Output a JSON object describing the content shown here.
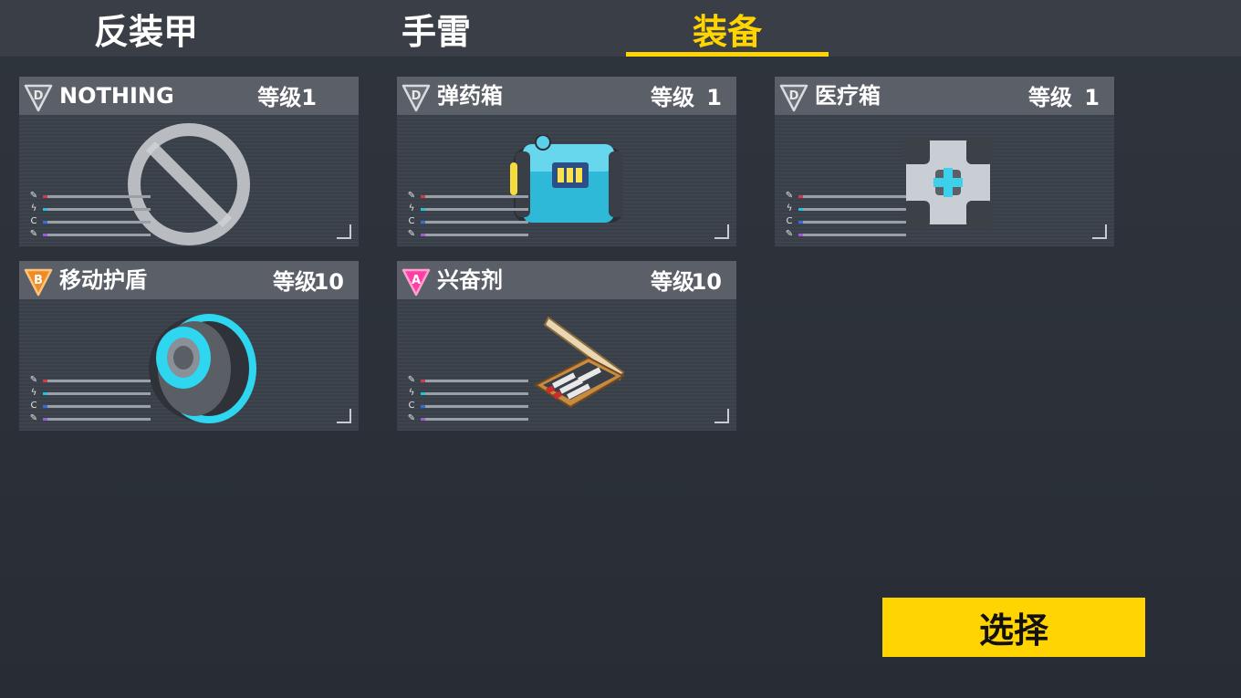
{
  "tabs": [
    {
      "label": "反装甲"
    },
    {
      "label": "手雷"
    },
    {
      "label": "装备"
    }
  ],
  "active_tab": "装备",
  "colors": {
    "accent": "#ffd400",
    "rank_D": "#c9ccd1",
    "rank_B": "#f08a24",
    "rank_A": "#ff3fa4",
    "stat_damage": "#d23a4a",
    "stat_energy": "#22c3d6",
    "stat_capacity": "#2e6fd8",
    "stat_range": "#9c5ad8"
  },
  "cards": [
    {
      "rank": "D",
      "name": "NOTHING",
      "level_label": "等级1",
      "level_value": "",
      "icon": "prohibited-icon"
    },
    {
      "rank": "D",
      "name": "弹药箱",
      "level_label": "等级",
      "level_value": "1",
      "icon": "ammo-box-icon"
    },
    {
      "rank": "D",
      "name": "医疗箱",
      "level_label": "等级",
      "level_value": "1",
      "icon": "medkit-icon"
    },
    {
      "rank": "B",
      "name": "移动护盾",
      "level_label": "等级",
      "level_value": "10",
      "icon": "mobile-shield-icon"
    },
    {
      "rank": "A",
      "name": "兴奋剂",
      "level_label": "等级",
      "level_value": "10",
      "icon": "stimulant-icon"
    }
  ],
  "stat_icons": [
    "damage-icon",
    "energy-icon",
    "capacity-icon",
    "range-icon"
  ],
  "select_button": {
    "label": "选择"
  }
}
